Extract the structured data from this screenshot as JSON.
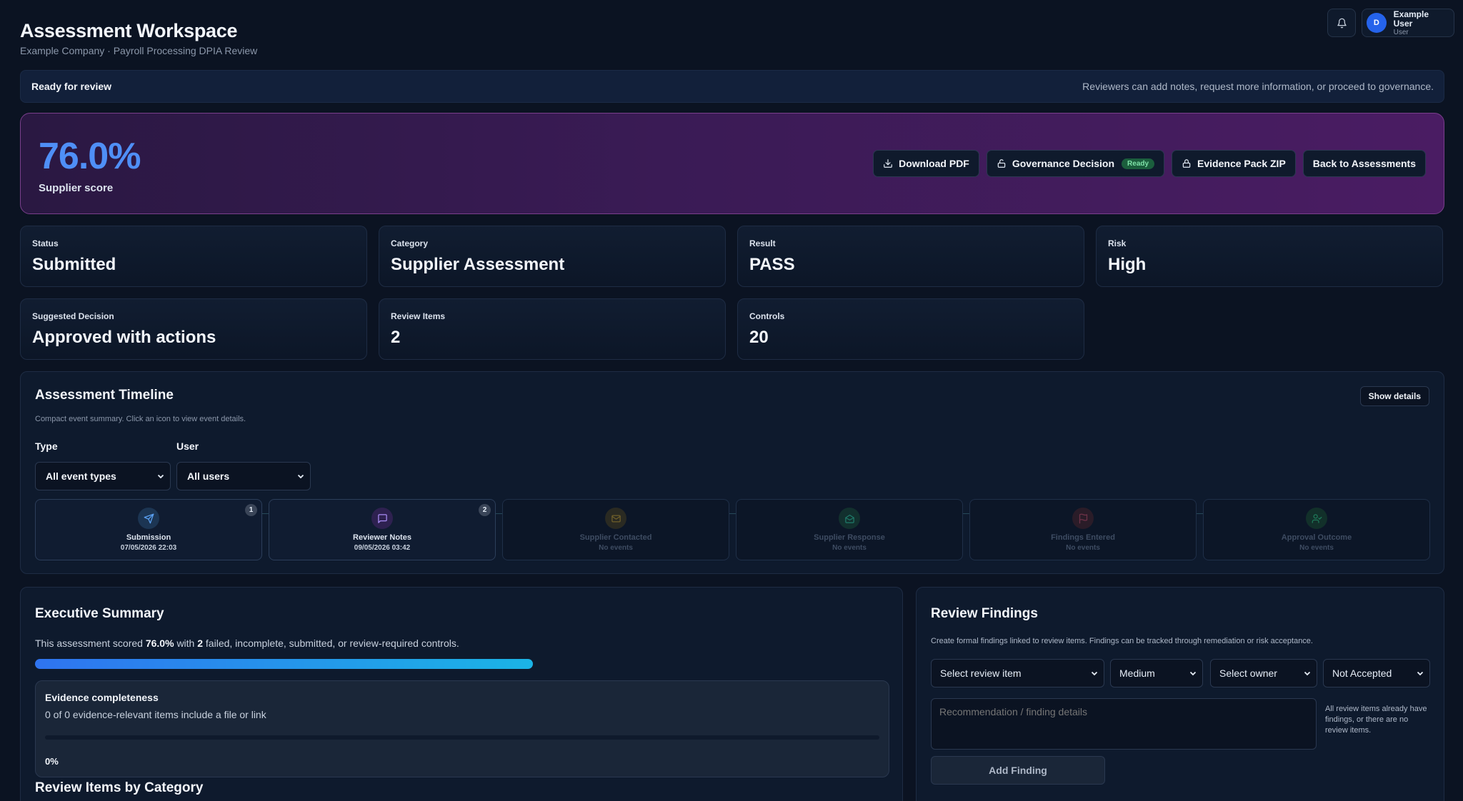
{
  "header": {
    "title": "Assessment Workspace",
    "subtitle": "Example Company · Payroll Processing DPIA Review",
    "user": {
      "initial": "D",
      "name": "Example User",
      "role": "User"
    }
  },
  "ready_bar": {
    "status": "Ready for review",
    "message": "Reviewers can add notes, request more information, or proceed to governance."
  },
  "hero": {
    "score": "76.0%",
    "score_label": "Supplier score",
    "buttons": {
      "download_pdf": "Download PDF",
      "governance": "Governance Decision",
      "governance_badge": "Ready",
      "evidence_zip": "Evidence Pack ZIP",
      "back": "Back to Assessments"
    }
  },
  "stats": [
    {
      "key": "Status",
      "value": "Submitted"
    },
    {
      "key": "Category",
      "value": "Supplier Assessment"
    },
    {
      "key": "Result",
      "value": "PASS"
    },
    {
      "key": "Risk",
      "value": "High"
    },
    {
      "key": "Suggested Decision",
      "value": "Approved with actions"
    },
    {
      "key": "Review Items",
      "value": "2"
    },
    {
      "key": "Controls",
      "value": "20"
    }
  ],
  "timeline": {
    "title": "Assessment Timeline",
    "subtitle": "Compact event summary. Click an icon to view event details.",
    "show_details": "Show details",
    "filters": {
      "type_label": "Type",
      "type_value": "All event types",
      "user_label": "User",
      "user_value": "All users"
    },
    "steps": [
      {
        "label": "Submission",
        "date": "07/05/2026 22:03",
        "count": "1"
      },
      {
        "label": "Reviewer Notes",
        "date": "09/05/2026 03:42",
        "count": "2"
      },
      {
        "label": "Supplier Contacted",
        "date": "No events"
      },
      {
        "label": "Supplier Response",
        "date": "No events"
      },
      {
        "label": "Findings Entered",
        "date": "No events"
      },
      {
        "label": "Approval Outcome",
        "date": "No events"
      }
    ]
  },
  "executive": {
    "title": "Executive Summary",
    "text_pre": "This assessment scored",
    "score": "76.0%",
    "text_mid": "with",
    "failed_count": "2",
    "text_post": "failed, incomplete, submitted, or review-required controls.",
    "progress_fraction": 0.584,
    "evidence": {
      "title": "Evidence completeness",
      "subtitle": "0 of 0 evidence-relevant items include a file or link",
      "percent": "0%"
    },
    "section_title": "Review Items by Category"
  },
  "findings": {
    "title": "Review Findings",
    "description": "Create formal findings linked to review items. Findings can be tracked through remediation or risk acceptance.",
    "review_item": "Select review item",
    "severity": "Medium",
    "owner": "Select owner",
    "acceptance": "Not Accepted",
    "placeholder": "Recommendation / finding details",
    "note": "All review items already have findings, or there are no review items.",
    "add_button": "Add Finding"
  },
  "colors": {
    "background": "#0b1322",
    "accent": "#4f8ff7",
    "ready_badge": "#1b5e3d",
    "hero_border": "#7a3f8c"
  },
  "icons": {
    "bell": "bell-icon",
    "download": "download-icon",
    "lock": "lock-icon",
    "chevron": "chevron-down-icon",
    "submission": "send-icon",
    "reviewer_notes": "message-icon",
    "supplier_contacted": "mail-icon",
    "supplier_response": "mail-open-icon",
    "findings_entered": "flag-icon",
    "approval_outcome": "user-check-icon"
  }
}
